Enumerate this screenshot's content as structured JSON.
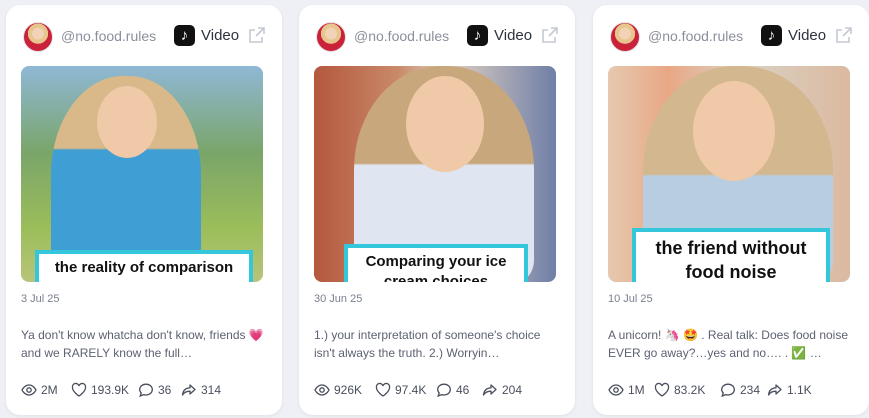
{
  "cards": [
    {
      "handle": "@no.food.rules",
      "platform_label": "Video",
      "caption": "the reality of comparison",
      "date": "3 Jul 25",
      "description": "Ya don't know whatcha don't know, friends 💗 and we RARELY know the full…",
      "stats": {
        "views": "2M",
        "likes": "193.9K",
        "comments": "36",
        "shares": "314"
      }
    },
    {
      "handle": "@no.food.rules",
      "platform_label": "Video",
      "caption": "Comparing your ice cream choices",
      "date": "30 Jun 25",
      "description": "1.) your interpretation of someone's choice isn't always the truth. 2.) Worryin…",
      "stats": {
        "views": "926K",
        "likes": "97.4K",
        "comments": "46",
        "shares": "204"
      }
    },
    {
      "handle": "@no.food.rules",
      "platform_label": "Video",
      "caption": "the friend without food noise",
      "date": "10 Jul 25",
      "description": "A unicorn! 🦄 🤩 . Real talk: Does food noise EVER go away?…yes and no…. . ✅ …",
      "stats": {
        "views": "1M",
        "likes": "83.2K",
        "comments": "234",
        "shares": "1.1K"
      }
    }
  ],
  "icons": {
    "platform": "tiktok-icon",
    "external": "external-link-icon",
    "views": "eye-icon",
    "likes": "heart-icon",
    "comments": "comment-icon",
    "shares": "share-icon"
  },
  "colors": {
    "caption_border": "#34c7dc",
    "background": "#eef0f5"
  }
}
